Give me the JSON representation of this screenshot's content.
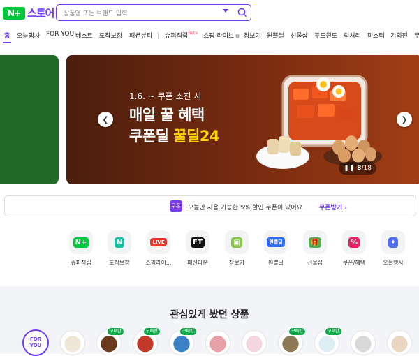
{
  "header": {
    "logo_mark": "N+",
    "logo_text": "스토어",
    "search_placeholder": "상품명 또는 브랜드 입력"
  },
  "nav": {
    "items": [
      "홈",
      "오늘행사",
      "FOR YOU",
      "베스트",
      "도착보장",
      "패션뷰티",
      "슈퍼적립",
      "쇼핑 라이브",
      "장보기",
      "원쁠딜",
      "선물샵",
      "푸드윈도",
      "럭셔리",
      "미스터",
      "기획전",
      "무"
    ],
    "beta": "Beta"
  },
  "hero": {
    "sub": "1.6. ~ 쿠폰 소진 시",
    "line1": "매일 꿀 혜택",
    "line2_prefix": "쿠폰딜 ",
    "line2_highlight": "꿀딜24",
    "pause": "❚❚",
    "page_current": "8",
    "page_total": "/18"
  },
  "coupon": {
    "icon": "쿠폰",
    "text": "오늘만 사용 가능한 5% 할인 쿠폰이 있어요",
    "action": "쿠폰받기"
  },
  "categories": [
    {
      "label": "슈퍼적립",
      "icon": "super-point-icon",
      "glyph": "N+",
      "color": "#00c73c"
    },
    {
      "label": "도착보장",
      "icon": "delivery-guarantee-icon",
      "glyph": "N",
      "color": "#13c2a4"
    },
    {
      "label": "쇼핑라이...",
      "icon": "live-icon",
      "glyph": "LIVE",
      "color": "#e8332a"
    },
    {
      "label": "패션타운",
      "icon": "fashion-town-icon",
      "glyph": "FT",
      "color": "#111"
    },
    {
      "label": "장보기",
      "icon": "grocery-icon",
      "glyph": "▣",
      "color": "#8bc34a"
    },
    {
      "label": "원쁠딜",
      "icon": "one-plus-deal-icon",
      "glyph": "원쁠딜",
      "color": "#2d6cf6"
    },
    {
      "label": "선물샵",
      "icon": "gift-icon",
      "glyph": "🎁",
      "color": "#4caf50"
    },
    {
      "label": "쿠폰/혜택",
      "icon": "coupon-benefit-icon",
      "glyph": "%",
      "color": "#e91e63"
    },
    {
      "label": "오늘행사",
      "icon": "today-event-icon",
      "glyph": "✦",
      "color": "#4f6cf7"
    }
  ],
  "recent": {
    "title": "관심있게 봤던 상품",
    "for_you_line1": "FOR",
    "for_you_line2": "YOU",
    "tag": "구매한",
    "colors": [
      "#efe6d8",
      "#6b3a1f",
      "#c0392b",
      "#3b82c4",
      "#e8a1a8",
      "#f3d6e0",
      "#8c7a55",
      "#dfeef4",
      "#d9d9d9",
      "#e9d7c4"
    ]
  }
}
